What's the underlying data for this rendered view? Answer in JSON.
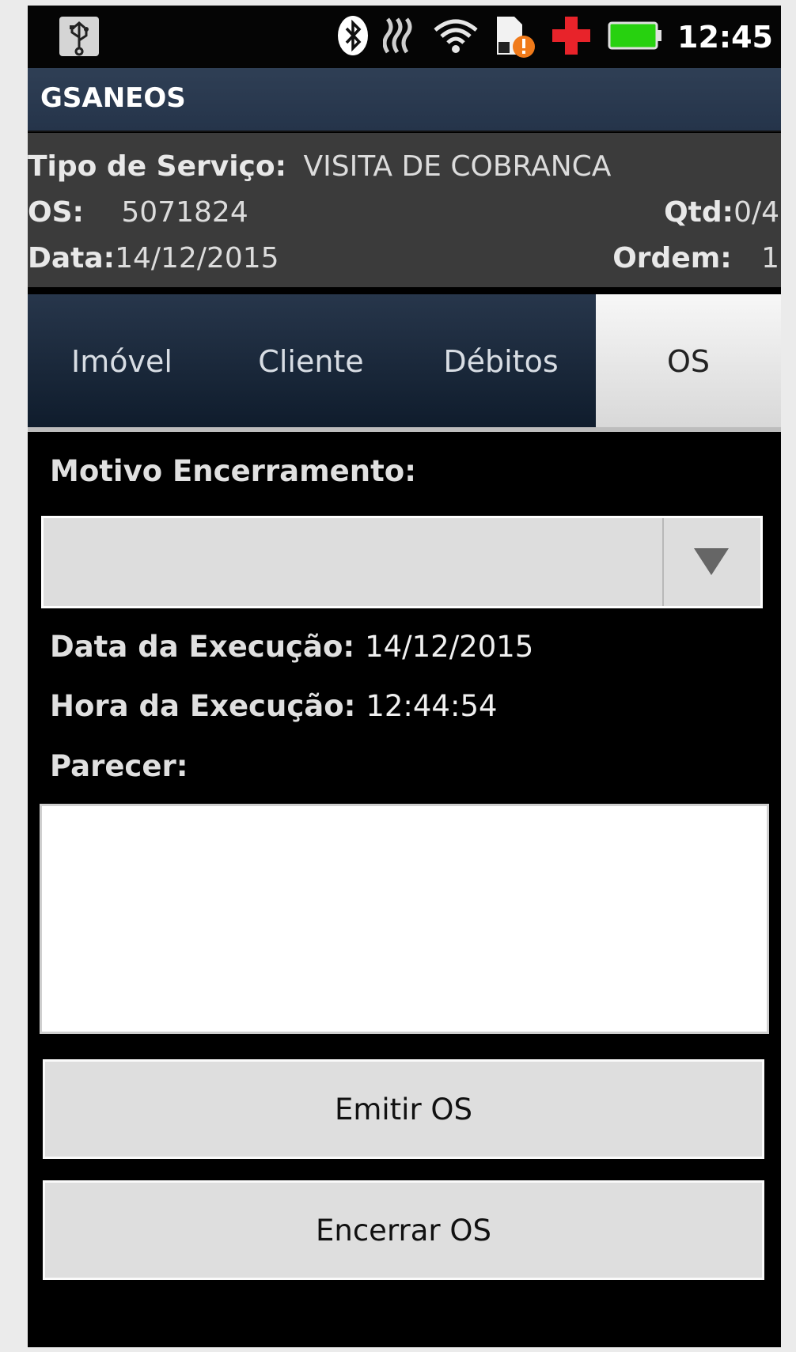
{
  "status_bar": {
    "time": "12:45",
    "icons": [
      "usb-icon",
      "bluetooth-icon",
      "signal-waves-icon",
      "wifi-icon",
      "sd-card-warning-icon",
      "medical-cross-icon",
      "battery-icon"
    ]
  },
  "app": {
    "title": "GSANEOS"
  },
  "header": {
    "tipo_label": "Tipo de Serviço:",
    "tipo_value": "VISITA DE COBRANCA",
    "os_label": "OS:",
    "os_value": "5071824",
    "qtd_label": "Qtd:",
    "qtd_value": "0/4",
    "data_label": "Data:",
    "data_value": "14/12/2015",
    "ordem_label": "Ordem:",
    "ordem_value": "1"
  },
  "tabs": [
    {
      "label": "Imóvel",
      "active": false
    },
    {
      "label": "Cliente",
      "active": false
    },
    {
      "label": "Débitos",
      "active": false
    },
    {
      "label": "OS",
      "active": true
    }
  ],
  "form": {
    "motivo_label": "Motivo Encerramento:",
    "motivo_value": "",
    "data_exec_label": "Data da Execução:",
    "data_exec_value": "14/12/2015",
    "hora_exec_label": "Hora da Execução:",
    "hora_exec_value": "12:44:54",
    "parecer_label": "Parecer:",
    "parecer_value": ""
  },
  "buttons": {
    "emitir": "Emitir OS",
    "encerrar": "Encerrar OS"
  },
  "colors": {
    "titlebar": "#2f3f55",
    "header_bg": "#3b3b3b",
    "tab_bg": "#1b2a3d",
    "tab_active_bg": "#e6e6e6",
    "battery": "#27d10f",
    "alert": "#f07a1a",
    "cross": "#e8232a"
  }
}
